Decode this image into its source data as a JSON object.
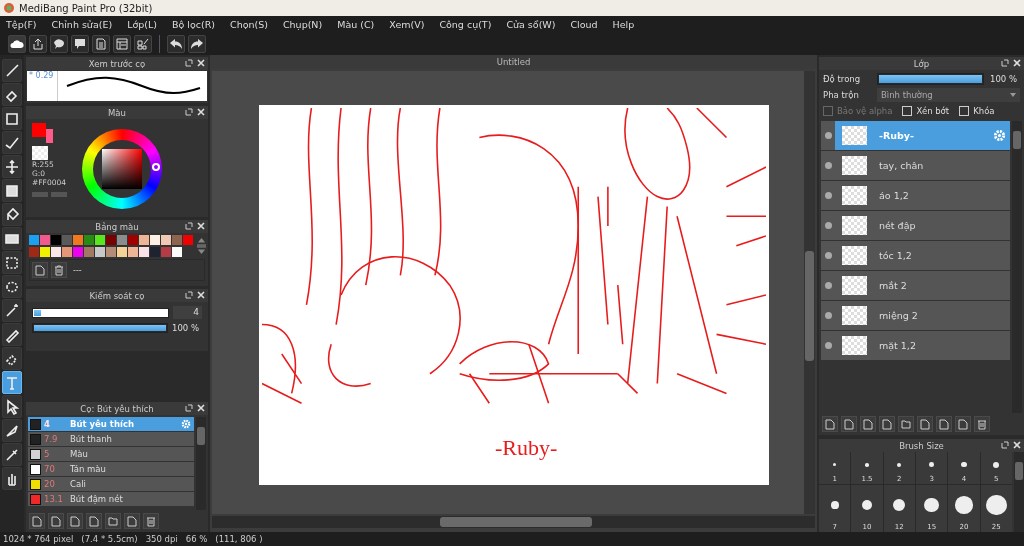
{
  "window": {
    "title": "MediBang Paint Pro (32bit)"
  },
  "menu": [
    "Tệp(F)",
    "Chỉnh sửa(E)",
    "Lớp(L)",
    "Bộ lọc(R)",
    "Chọn(S)",
    "Chụp(N)",
    "Màu (C)",
    "Xem(V)",
    "Công cụ(T)",
    "Cửa sổ(W)",
    "Cloud",
    "Help"
  ],
  "tools": [
    {
      "kind": "brush",
      "selected": false
    },
    {
      "kind": "eraser",
      "selected": false
    },
    {
      "kind": "square",
      "selected": false
    },
    {
      "kind": "checkmark",
      "selected": false
    },
    {
      "kind": "move",
      "selected": false
    },
    {
      "kind": "filled-square",
      "selected": false
    },
    {
      "kind": "bucket",
      "selected": false
    },
    {
      "kind": "gradient",
      "selected": false
    },
    {
      "kind": "dashed-square",
      "selected": false
    },
    {
      "kind": "dashed-loop",
      "selected": false
    },
    {
      "kind": "wand",
      "selected": false
    },
    {
      "kind": "pen",
      "selected": false
    },
    {
      "kind": "dashed-eraser",
      "selected": false
    },
    {
      "kind": "text",
      "selected": true
    },
    {
      "kind": "pointer",
      "selected": false
    },
    {
      "kind": "knife",
      "selected": false
    },
    {
      "kind": "eyedropper",
      "selected": false
    },
    {
      "kind": "hand",
      "selected": false
    }
  ],
  "brush_preview": {
    "title": "Xem trước cọ",
    "value": "* 0.29"
  },
  "color": {
    "title": "Màu",
    "swatches": [
      {
        "kind": "foreground",
        "color": "#ff0000"
      },
      {
        "kind": "background",
        "color": "#ff5a8a"
      }
    ],
    "readouts": [
      "R:255",
      "G:0",
      "#FF0004"
    ]
  },
  "palette": {
    "title": "Bảng màu",
    "colors": [
      {
        "color": "#1ea0f0"
      },
      {
        "color": "#f05a8c"
      },
      {
        "color": "#000000"
      },
      {
        "color": "#5a5a5a"
      },
      {
        "color": "#f07820"
      },
      {
        "color": "#288c14"
      },
      {
        "color": "#5ae61e"
      },
      {
        "color": "#780000"
      },
      {
        "color": "#8c8c8c"
      },
      {
        "color": "#a00000"
      },
      {
        "color": "#f0b496"
      },
      {
        "color": "#fff0e6"
      },
      {
        "color": "#f0c8b4"
      },
      {
        "color": "#8c6450"
      },
      {
        "color": "#f00000"
      },
      {
        "color": "#a02814"
      },
      {
        "color": "#f0f000"
      },
      {
        "color": "#fae6e6"
      },
      {
        "color": "#e69678"
      },
      {
        "color": "#f000f0"
      },
      {
        "color": "#a07864"
      },
      {
        "color": "#c8c8c8"
      },
      {
        "color": "#b48c78"
      },
      {
        "color": "#f5d296"
      },
      {
        "color": "#f0b496"
      },
      {
        "color": "#fae1e6"
      },
      {
        "color": "#1e2332"
      },
      {
        "color": "#b43c46"
      },
      {
        "color": "#fafafa"
      }
    ],
    "name": "---"
  },
  "brush_control": {
    "title": "Kiểm soát cọ",
    "size": {
      "level": 0.05,
      "reading": "4"
    },
    "opacity": {
      "level": 1,
      "reading": "100 %"
    }
  },
  "brushes": {
    "title": "Cọ: Bút yêu thích",
    "items": [
      {
        "size": "4",
        "name": "Bút yêu thích",
        "color": "#222222",
        "selected": true
      },
      {
        "size": "7.9",
        "name": "Bút thanh",
        "color": "#222222",
        "selected": false
      },
      {
        "size": "5",
        "name": "Màu",
        "color": "#d2d2d2",
        "selected": false
      },
      {
        "size": "70",
        "name": "Tán màu",
        "color": "#ffffff",
        "selected": false
      },
      {
        "size": "20",
        "name": "Cali",
        "color": "#f0e000",
        "selected": false
      },
      {
        "size": "13.1",
        "name": "Bút đậm nét",
        "color": "#f02828",
        "selected": false
      }
    ]
  },
  "canvas": {
    "tab": "Untitled",
    "signature": "-Ruby-"
  },
  "layers": {
    "title": "Lớp",
    "opacity": {
      "label": "Độ trong",
      "level": 1,
      "reading": "100 %"
    },
    "blend": {
      "label": "Pha trộn",
      "value": "Bình thường"
    },
    "options": [
      {
        "label": "Bảo vệ alpha",
        "checked": false,
        "disabled": true
      },
      {
        "label": "Xén bớt",
        "checked": false,
        "disabled": false
      },
      {
        "label": "Khóa",
        "checked": false,
        "disabled": false
      }
    ],
    "items": [
      {
        "name": "-Ruby-",
        "selected": true
      },
      {
        "name": "tay, chân",
        "selected": false
      },
      {
        "name": "áo 1,2",
        "selected": false
      },
      {
        "name": "nét đập",
        "selected": false
      },
      {
        "name": "tóc 1,2",
        "selected": false
      },
      {
        "name": "mắt 2",
        "selected": false
      },
      {
        "name": "miệng 2",
        "selected": false
      },
      {
        "name": "mặt 1,2",
        "selected": false
      }
    ]
  },
  "brush_size": {
    "title": "Brush Size",
    "sizes": [
      "1",
      "1.5",
      "2",
      "3",
      "4",
      "5",
      "7",
      "10",
      "12",
      "15",
      "20",
      "25"
    ]
  },
  "status_bar": [
    "1024 * 764 pixel",
    "(7.4 * 5.5cm)",
    "350 dpi",
    "66 %",
    "(111, 806 )"
  ]
}
